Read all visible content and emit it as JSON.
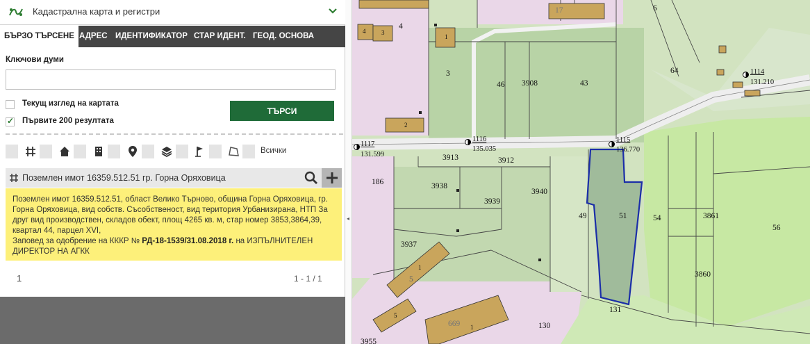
{
  "header": {
    "title": "Кадастрална карта и регистри"
  },
  "tabs": [
    {
      "label": "БЪРЗО ТЪРСЕНЕ"
    },
    {
      "label": "АДРЕС"
    },
    {
      "label": "ИДЕНТИФИКАТОР"
    },
    {
      "label": "СТАР ИДЕНТ."
    },
    {
      "label": "ГЕОД. ОСНОВА"
    }
  ],
  "search": {
    "keywords_label": "Ключови думи",
    "keywords_value": "",
    "current_view_label": "Текущ изглед на картата",
    "first200_label": "Първите 200 резултата",
    "button_label": "ТЪРСИ"
  },
  "layers": {
    "all_label": "Всички"
  },
  "result": {
    "title": "Поземлен имот 16359.512.51 гр. Горна Оряховица",
    "description": "Поземлен имот 16359.512.51, област Велико Търново, община Горна Оряховица, гр. Горна Оряховица, вид собств. Съсобственост, вид територия Урбанизирана, НТП За друг вид производствен, складов обект, площ 4265 кв. м, стар номер 3853,3864,39, квартал 44, парцел XVI,",
    "order_prefix": "Заповед за одобрение на КККР №",
    "order_number": "РД-18-1539/31.08.2018 г.",
    "order_suffix": "на ИЗПЪЛНИТЕЛЕН ДИРЕКТОР НА АГКК"
  },
  "pager": {
    "page": "1",
    "range": "1 - 1 / 1"
  },
  "map": {
    "labels": {
      "p17": "17",
      "p6": "6",
      "p4": "4",
      "b4": "4",
      "b3": "3",
      "b1a": "1",
      "p3": "3",
      "p46": "46",
      "p3908": "3908",
      "p43": "43",
      "p64": "64",
      "p2": "2",
      "p186": "186",
      "p3913": "3913",
      "p3912": "3912",
      "p3938": "3938",
      "p3939": "3939",
      "p3940": "3940",
      "p49": "49",
      "p51": "51",
      "p54": "54",
      "p3861": "3861",
      "p56": "56",
      "p3937": "3937",
      "b1b": "1",
      "p5a": "5",
      "p5b": "5",
      "p669": "669",
      "b1c": "1",
      "p130": "130",
      "p131": "131",
      "p3860": "3860",
      "p3955": "3955"
    },
    "geod": [
      {
        "id": "1117",
        "value": "131.599"
      },
      {
        "id": "1116",
        "value": "135.035"
      },
      {
        "id": "1115",
        "value": "136.770"
      },
      {
        "id": "1114",
        "value": "131.210"
      }
    ]
  },
  "colors": {
    "accent_green": "#1f6b38",
    "tab_bar": "#454545",
    "result_highlight": "#fdf07a",
    "selected_parcel_stroke": "#1b2ea8"
  }
}
